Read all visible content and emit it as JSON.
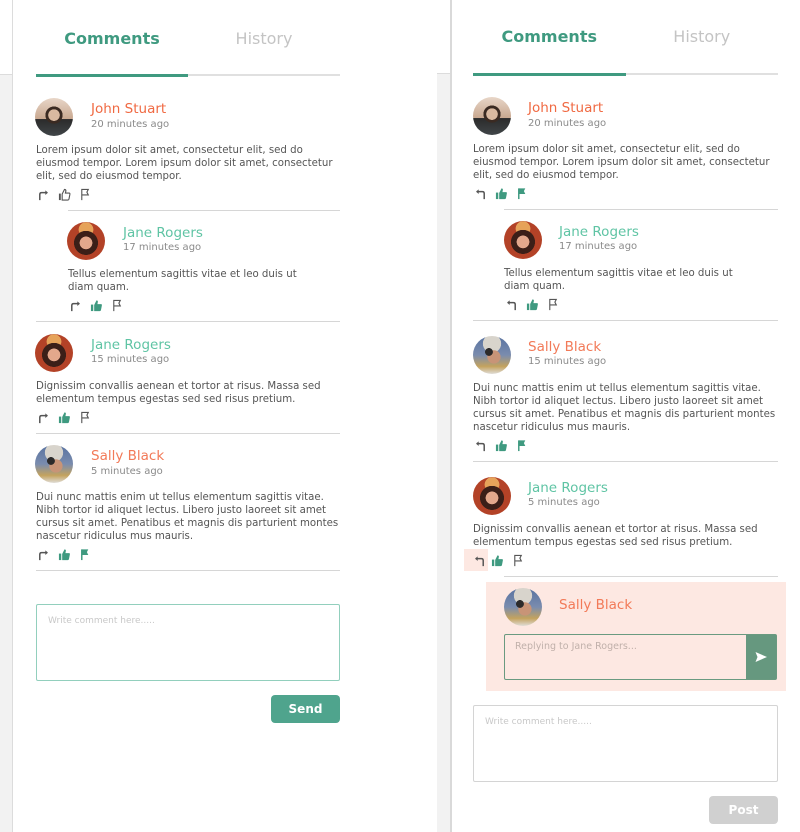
{
  "colors": {
    "accent": "#3f9a80",
    "author_orange": "#f06a43",
    "author_teal": "#5fc4a4",
    "reply_highlight": "#fde8e2",
    "send_button": "#4fa48d",
    "post_button_disabled": "#d0d0d0"
  },
  "left_panel": {
    "tabs": [
      {
        "label": "Comments",
        "active": true
      },
      {
        "label": "History",
        "active": false
      }
    ],
    "comments": [
      {
        "author": "John Stuart",
        "avatar": "john-stuart-avatar",
        "time": "20 minutes ago",
        "text": "Lorem ipsum dolor sit amet, consectetur elit, sed do eiusmod tempor. Lorem ipsum dolor sit amet, consectetur elit, sed do eiusmod tempor.",
        "liked": false,
        "flagged": false,
        "replies": [
          {
            "author": "Jane Rogers",
            "avatar": "jane-rogers-avatar",
            "time": "17 minutes ago",
            "text": "Tellus elementum sagittis vitae et leo duis ut diam quam.",
            "liked": true,
            "flagged": false
          }
        ]
      },
      {
        "author": "Jane Rogers",
        "avatar": "jane-rogers-avatar",
        "time": "15 minutes ago",
        "text": "Dignissim convallis aenean et tortor at risus. Massa sed elementum tempus egestas sed sed risus pretium.",
        "liked": true,
        "flagged": false
      },
      {
        "author": "Sally Black",
        "avatar": "sally-black-avatar",
        "time": "5 minutes ago",
        "text": "Dui nunc mattis enim ut tellus elementum sagittis vitae. Nibh tortor id aliquet lectus. Libero justo laoreet sit amet cursus sit amet. Penatibus et magnis dis parturient montes nascetur ridiculus mus mauris.",
        "liked": true,
        "flagged": true
      }
    ],
    "composer": {
      "placeholder": "Write comment here.....",
      "value": "",
      "button_label": "Send"
    }
  },
  "right_panel": {
    "tabs": [
      {
        "label": "Comments",
        "active": true
      },
      {
        "label": "History",
        "active": false
      }
    ],
    "comments": [
      {
        "author": "John Stuart",
        "avatar": "john-stuart-avatar",
        "time": "20 minutes ago",
        "text": "Lorem ipsum dolor sit amet, consectetur elit, sed do eiusmod tempor. Lorem ipsum dolor sit amet, consectetur elit, sed do eiusmod tempor.",
        "liked": true,
        "flagged": true,
        "replies": [
          {
            "author": "Jane Rogers",
            "avatar": "jane-rogers-avatar",
            "time": "17 minutes ago",
            "text": "Tellus elementum sagittis vitae et leo duis ut diam quam.",
            "liked": true,
            "flagged": false
          }
        ]
      },
      {
        "author": "Sally Black",
        "avatar": "sally-black-avatar",
        "time": "15 minutes ago",
        "text": "Dui nunc mattis enim ut tellus elementum sagittis vitae. Nibh tortor id aliquet lectus. Libero justo laoreet sit amet cursus sit amet. Penatibus et magnis dis parturient montes nascetur ridiculus mus mauris.",
        "liked": true,
        "flagged": true
      },
      {
        "author": "Jane Rogers",
        "avatar": "jane-rogers-avatar",
        "time": "5 minutes ago",
        "text": "Dignissim convallis aenean et tortor at risus. Massa sed elementum tempus egestas sed sed risus pretium.",
        "liked": true,
        "flagged": false,
        "reply_active": true
      }
    ],
    "reply_box": {
      "author": "Sally Black",
      "avatar": "sally-black-avatar",
      "placeholder": "Replying to Jane Rogers...",
      "value": ""
    },
    "composer": {
      "placeholder": "Write comment here.....",
      "value": "",
      "button_label": "Post",
      "button_disabled": true
    }
  }
}
